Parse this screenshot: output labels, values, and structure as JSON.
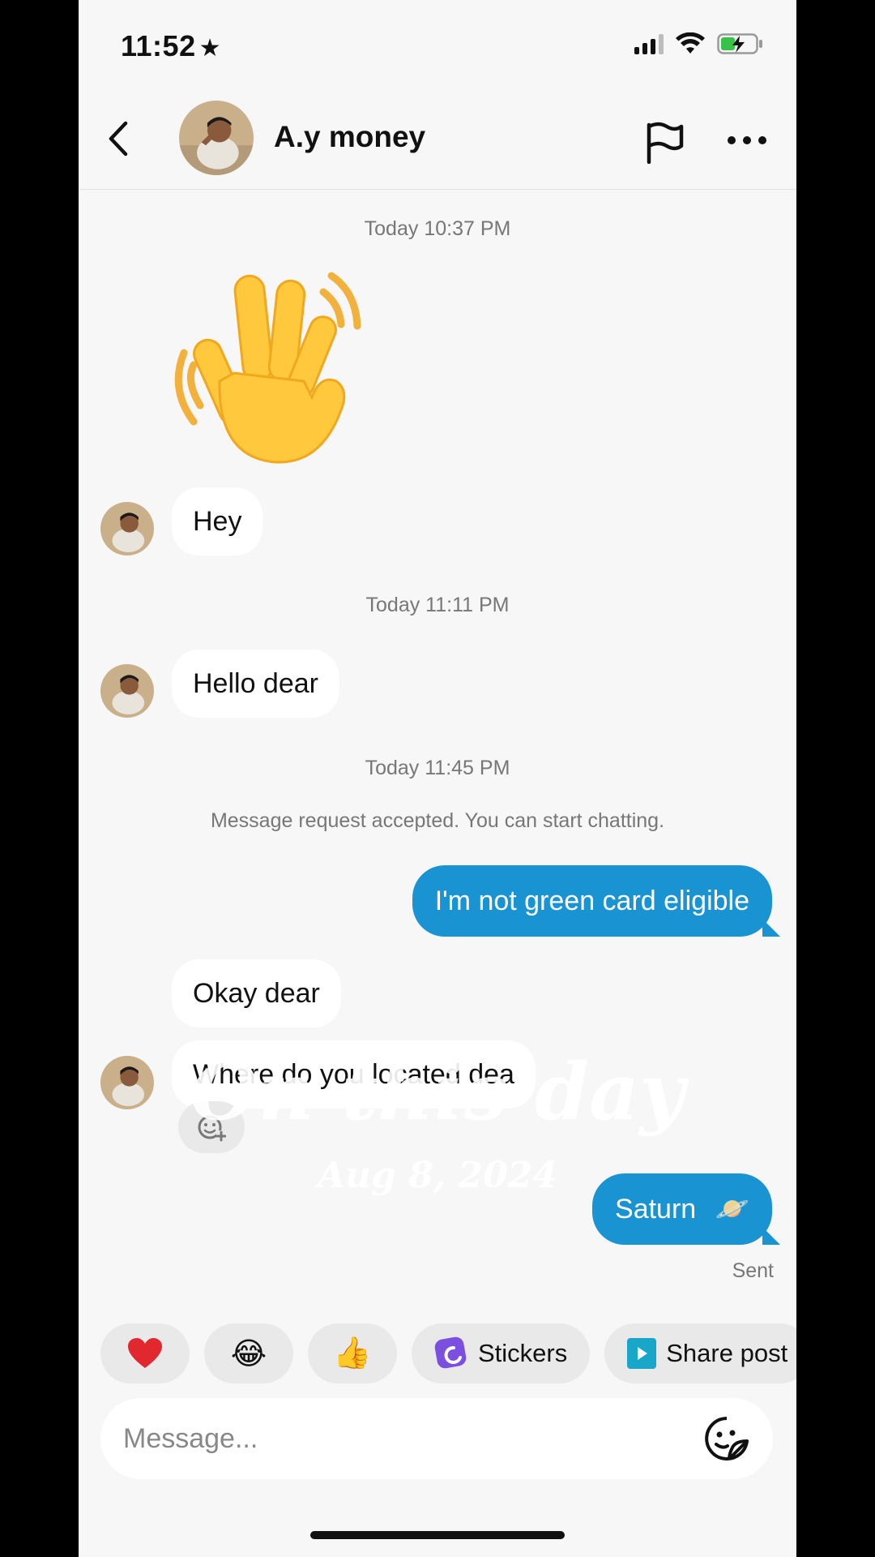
{
  "status_bar": {
    "time": "11:52",
    "time_icon": "star-icon",
    "icons": [
      "cellular-signal-icon",
      "wifi-icon",
      "battery-charging-icon"
    ]
  },
  "header": {
    "contact_name": "A.y money",
    "back_icon": "chevron-left-icon",
    "report_icon": "flag-icon",
    "more_icon": "ellipsis-icon"
  },
  "messages": {
    "ts1": "Today 10:37 PM",
    "wave_sticker": "👋",
    "msg1": "Hey",
    "ts2": "Today 11:11 PM",
    "msg2": "Hello dear",
    "ts3": "Today 11:45 PM",
    "system_notice": "Message request accepted. You can start chatting.",
    "out1": "I'm not green card eligible",
    "msg3": "Okay dear",
    "msg4": "Where do you located dea",
    "out2": "Saturn",
    "out2_emoji": "🪐",
    "sent_status": "Sent"
  },
  "overlay": {
    "line1": "On this day",
    "line2": "Aug 8, 2024"
  },
  "quick_replies": {
    "heart": "❤️",
    "laugh": "😂",
    "thumbs": "👍",
    "stickers": "Stickers",
    "share_post": "Share post"
  },
  "composer": {
    "placeholder": "Message..."
  },
  "colors": {
    "outgoing_bubble": "#1a93d3",
    "incoming_bubble": "#ffffff",
    "background": "#f7f7f7"
  }
}
